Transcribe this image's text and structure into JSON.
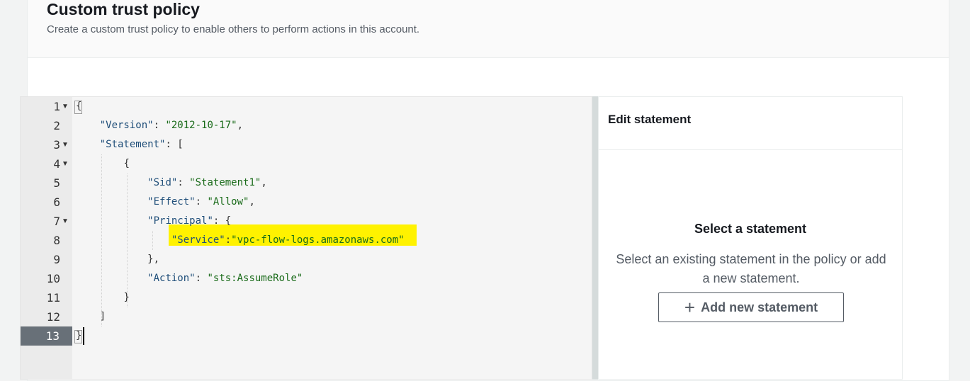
{
  "header": {
    "title": "Custom trust policy",
    "description": "Create a custom trust policy to enable others to perform actions in this account."
  },
  "editor": {
    "line_numbers": [
      "1",
      "2",
      "3",
      "4",
      "5",
      "6",
      "7",
      "8",
      "9",
      "10",
      "11",
      "12",
      "13"
    ],
    "active_line": "13",
    "code": {
      "l1": "{",
      "l2_key": "\"Version\"",
      "l2_sep": ": ",
      "l2_val": "\"2012-10-17\"",
      "l2_end": ",",
      "l3_key": "\"Statement\"",
      "l3_end": ": [",
      "l4": "{",
      "l5_key": "\"Sid\"",
      "l5_sep": ": ",
      "l5_val": "\"Statement1\"",
      "l5_end": ",",
      "l6_key": "\"Effect\"",
      "l6_sep": ": ",
      "l6_val": "\"Allow\"",
      "l6_end": ",",
      "l7_key": "\"Principal\"",
      "l7_end": ": {",
      "l8_key": "\"Service\"",
      "l8_sep": ":",
      "l8_val": "\"vpc-flow-logs.amazonaws.com\"",
      "l9": "},",
      "l10_key": "\"Action\"",
      "l10_sep": ": ",
      "l10_val": "\"sts:AssumeRole\"",
      "l11": "}",
      "l12": "]",
      "l13": "}"
    },
    "highlight_color": "#fff200"
  },
  "side_panel": {
    "title": "Edit statement",
    "empty_title": "Select a statement",
    "empty_description": "Select an existing statement in the policy or add a new statement.",
    "add_button_label": "Add new statement",
    "add_button_icon": "plus-icon"
  }
}
